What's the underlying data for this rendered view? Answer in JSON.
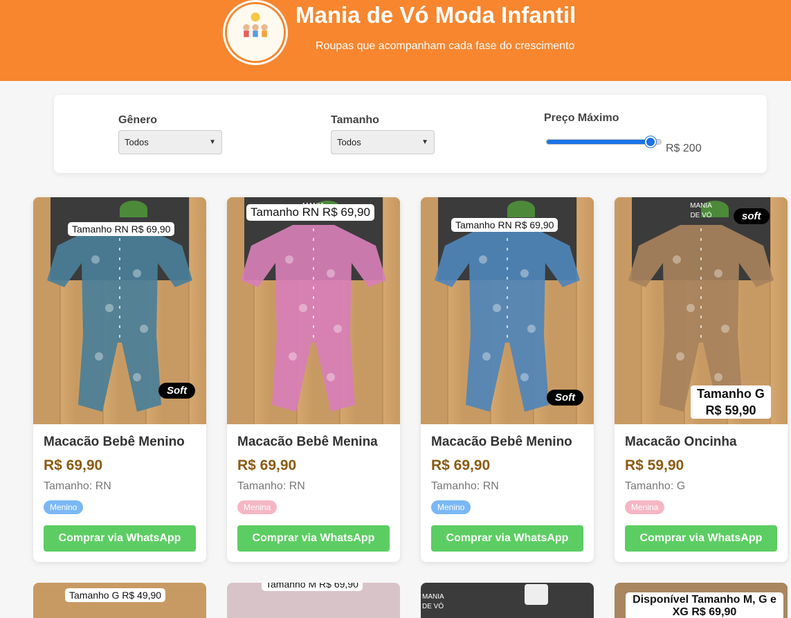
{
  "header": {
    "title": "Mania de Vó Moda Infantil",
    "subtitle": "Roupas que acompanham cada fase do crescimento",
    "logo_text": "Mania de Vó",
    "bg_color": "#f7862f"
  },
  "filters": {
    "gender_label": "Gênero",
    "gender_value": "Todos",
    "size_label": "Tamanho",
    "size_value": "Todos",
    "price_label": "Preço Máximo",
    "price_value": "R$ 200",
    "price_slider_fraction": 0.9
  },
  "products": [
    {
      "title": "Macacão Bebê Menino",
      "price": "R$ 69,90",
      "size": "Tamanho: RN",
      "badge": "Menino",
      "badge_type": "boy",
      "button": "Comprar via WhatsApp",
      "photo_tag": "Tamanho RN R$ 69,90",
      "photo_soft": "Soft",
      "garment_color": "#4a7f98"
    },
    {
      "title": "Macacão Bebê Menina",
      "price": "R$ 69,90",
      "size": "Tamanho: RN",
      "badge": "Menina",
      "badge_type": "girl",
      "button": "Comprar via WhatsApp",
      "photo_tag": "Tamanho RN R$ 69,90",
      "photo_brand": "MANIA VÓ",
      "garment_color": "#d77fb7"
    },
    {
      "title": "Macacão Bebê Menino",
      "price": "R$ 69,90",
      "size": "Tamanho: RN",
      "badge": "Menino",
      "badge_type": "boy",
      "button": "Comprar via WhatsApp",
      "photo_tag": "Tamanho RN R$ 69,90",
      "photo_soft": "Soft",
      "garment_color": "#4f86b8"
    },
    {
      "title": "Macacão Oncinha",
      "price": "R$ 59,90",
      "size": "Tamanho: G",
      "badge": "Menina",
      "badge_type": "girl",
      "button": "Comprar via WhatsApp",
      "photo_soft": "soft",
      "photo_brand": "MANIA DE VÓ",
      "photo_size_line1": "Tamanho G",
      "photo_size_line2": "R$ 59,90",
      "garment_color": "#a7825c"
    }
  ],
  "next_row": [
    {
      "photo_tag": "Tamanho G R$ 49,90"
    },
    {
      "photo_tag": "Tamanho M R$ 69,90"
    },
    {
      "photo_brand": "MANIA DE VÓ"
    },
    {
      "photo_tag": "Disponível Tamanho M, G e XG R$ 69,90"
    }
  ]
}
